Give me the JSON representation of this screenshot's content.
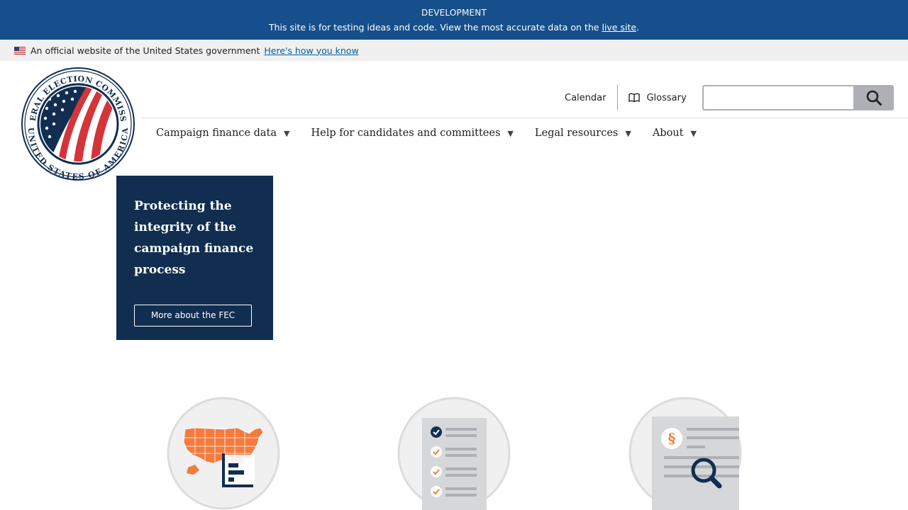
{
  "dev_banner": {
    "title": "DEVELOPMENT",
    "message": "This site is for testing ideas and code. View the most accurate data on the",
    "link": "live site",
    "suffix": "."
  },
  "gov_banner": {
    "text": "An official website of the United States government",
    "link": "Here's how you know"
  },
  "seal": {
    "top_text": "FEDERAL ELECTION COMMISSION",
    "bottom_text": "UNITED STATES OF AMERICA"
  },
  "utility": {
    "calendar": "Calendar",
    "glossary": "Glossary",
    "search_placeholder": ""
  },
  "nav": {
    "items": [
      {
        "label": "Campaign finance data"
      },
      {
        "label": "Help for candidates and committees"
      },
      {
        "label": "Legal resources"
      },
      {
        "label": "About"
      }
    ]
  },
  "hero": {
    "title": "Protecting the integrity of the campaign finance process",
    "button": "More about the FEC"
  },
  "features": {
    "icons": [
      "us-map-chart-icon",
      "checklist-icon",
      "legal-document-search-icon"
    ]
  },
  "colors": {
    "dev_banner": "#164f8b",
    "hero": "#112e51",
    "accent_orange": "#f47b3e",
    "navy": "#112e51",
    "link": "#005ea2"
  }
}
